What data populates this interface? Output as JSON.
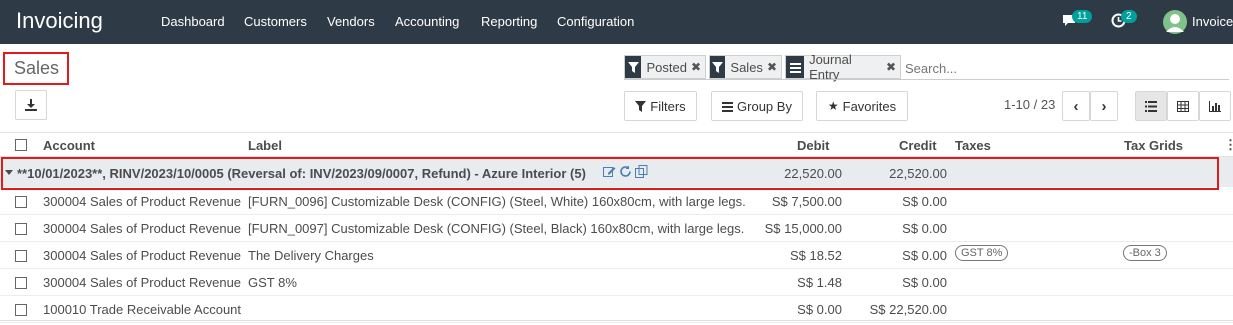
{
  "navbar": {
    "brand": "Invoicing",
    "menu": [
      "Dashboard",
      "Customers",
      "Vendors",
      "Accounting",
      "Reporting",
      "Configuration"
    ],
    "messages_count": "11",
    "activities_count": "2",
    "user": "Invoice"
  },
  "page": {
    "title": "Sales"
  },
  "search": {
    "facets": [
      {
        "icon": "filter-icon",
        "label": "Posted"
      },
      {
        "icon": "filter-icon",
        "label": "Sales"
      },
      {
        "icon": "list-icon",
        "label": "Journal Entry"
      }
    ],
    "placeholder": "Search..."
  },
  "controls": {
    "filters_label": "Filters",
    "group_by_label": "Group By",
    "favorites_label": "Favorites",
    "pager": "1-10 / 23"
  },
  "table": {
    "headers": {
      "account": "Account",
      "label": "Label",
      "debit": "Debit",
      "credit": "Credit",
      "taxes": "Taxes",
      "tax_grids": "Tax Grids"
    },
    "group": {
      "title": "**10/01/2023**, RINV/2023/10/0005 (Reversal of: INV/2023/09/0007, Refund) - Azure Interior (5)",
      "debit": "22,520.00",
      "credit": "22,520.00"
    },
    "rows": [
      {
        "account": "300004 Sales of Product Revenue",
        "label": "[FURN_0096] Customizable Desk (CONFIG) (Steel, White) 160x80cm, with large legs.",
        "debit": "S$ 7,500.00",
        "credit": "S$ 0.00",
        "tax": "",
        "grid": ""
      },
      {
        "account": "300004 Sales of Product Revenue",
        "label": "[FURN_0097] Customizable Desk (CONFIG) (Steel, Black) 160x80cm, with large legs.",
        "debit": "S$ 15,000.00",
        "credit": "S$ 0.00",
        "tax": "",
        "grid": ""
      },
      {
        "account": "300004 Sales of Product Revenue",
        "label": "The Delivery Charges",
        "debit": "S$ 18.52",
        "credit": "S$ 0.00",
        "tax": "GST 8%",
        "grid": "-Box 3"
      },
      {
        "account": "300004 Sales of Product Revenue",
        "label": "GST 8%",
        "debit": "S$ 1.48",
        "credit": "S$ 0.00",
        "tax": "",
        "grid": ""
      },
      {
        "account": "100010 Trade Receivable Account",
        "label": "",
        "debit": "S$ 0.00",
        "credit": "S$ 22,520.00",
        "tax": "",
        "grid": ""
      }
    ]
  },
  "colors": {
    "navbar": "#2f3a47",
    "badge": "#00a09d",
    "highlight": "#e21a1a"
  }
}
